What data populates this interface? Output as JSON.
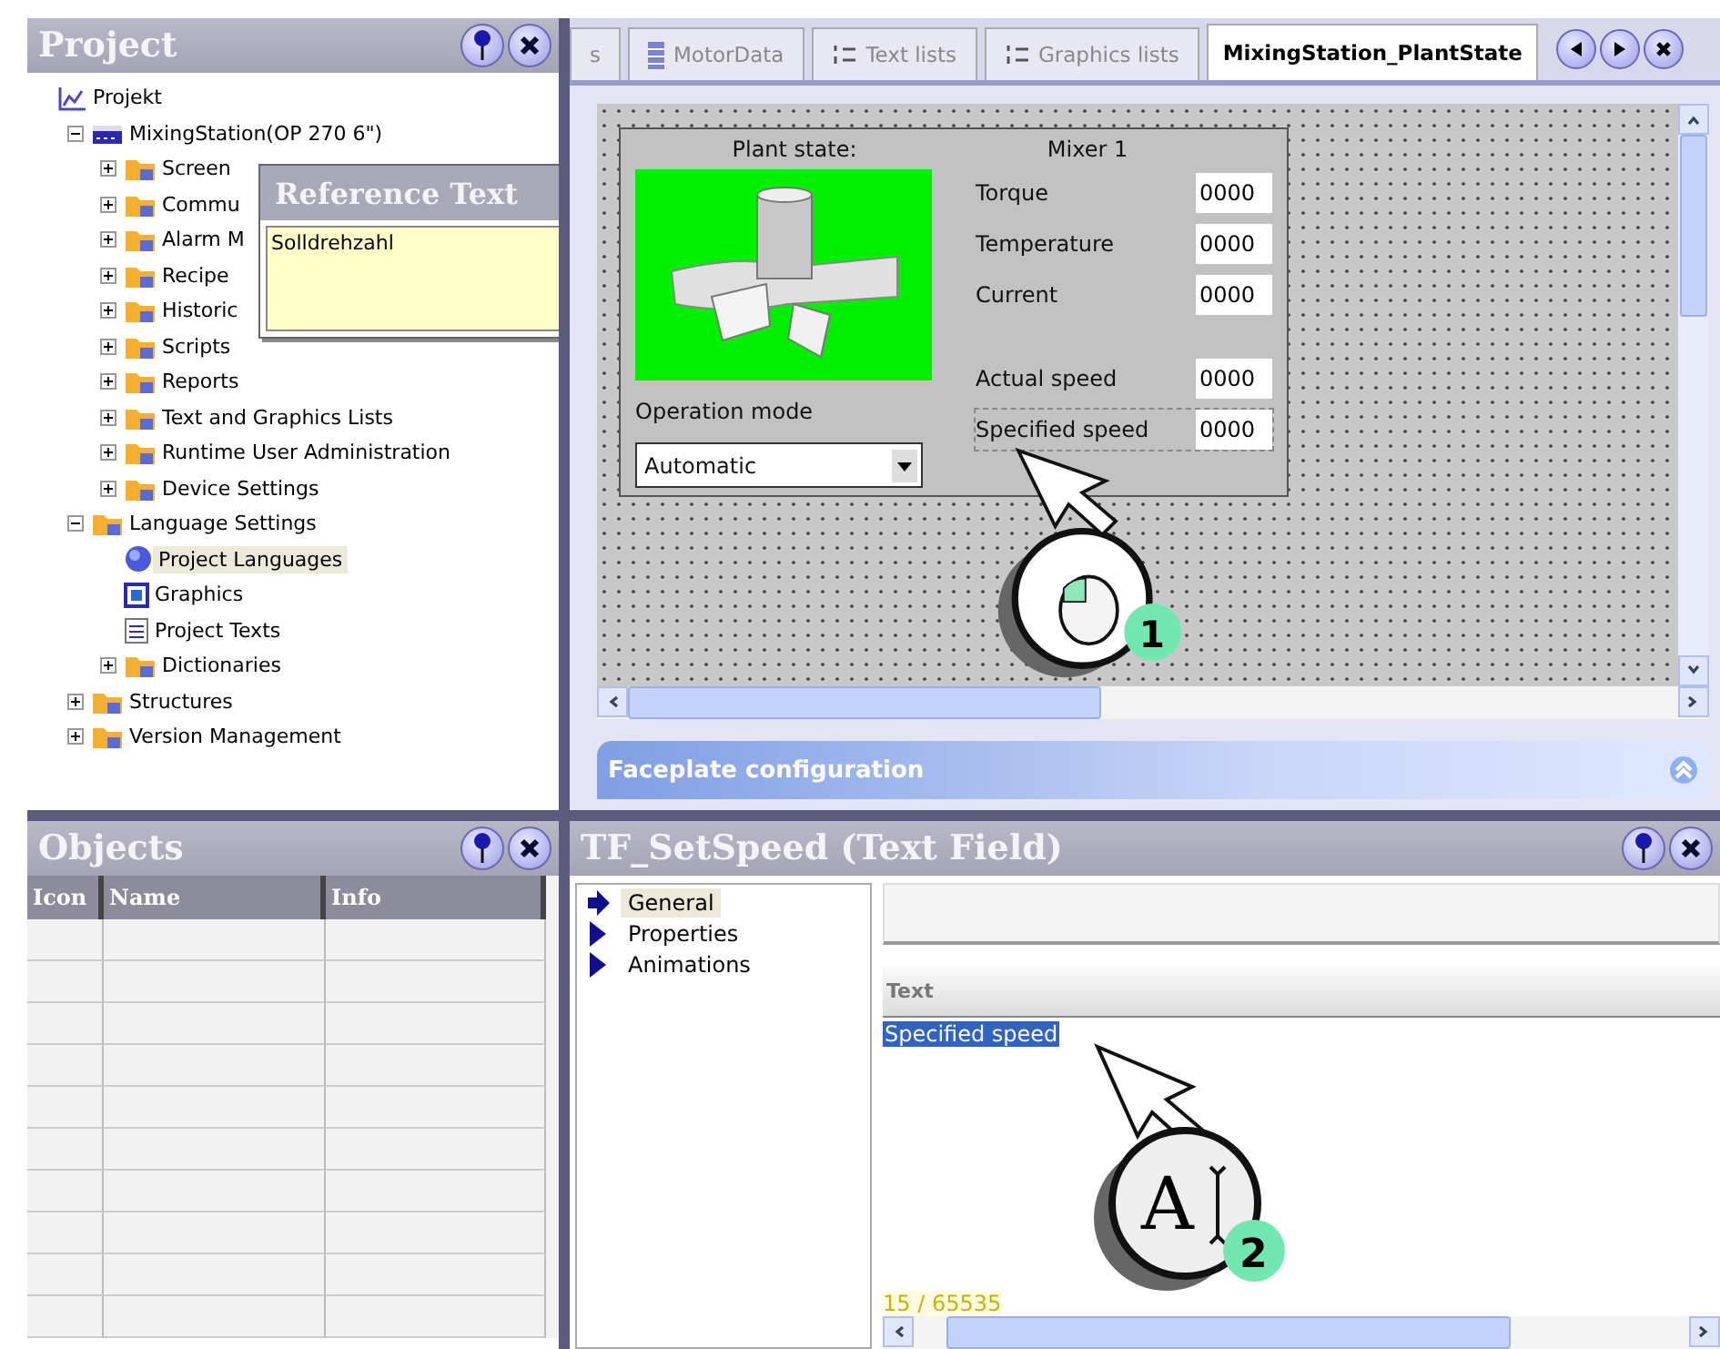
{
  "project_panel": {
    "title": "Project",
    "tree": [
      {
        "label": "Projekt",
        "kind": "chart",
        "children": [
          {
            "label": "MixingStation(OP 270 6\")",
            "kind": "device",
            "expanded": true,
            "selected": false,
            "children": [
              {
                "label": "Screen",
                "kind": "folder",
                "expanded": false,
                "selected": false
              },
              {
                "label": "Commu",
                "kind": "folder",
                "expanded": false,
                "selected": false
              },
              {
                "label": "Alarm M",
                "kind": "folder",
                "expanded": false,
                "selected": false
              },
              {
                "label": "Recipe",
                "kind": "folder",
                "expanded": false,
                "selected": false
              },
              {
                "label": "Historic",
                "kind": "folder",
                "expanded": false,
                "selected": false
              },
              {
                "label": "Scripts",
                "kind": "folder",
                "expanded": false,
                "selected": false
              },
              {
                "label": "Reports",
                "kind": "folder",
                "expanded": false,
                "selected": false
              },
              {
                "label": "Text and Graphics Lists",
                "kind": "folder",
                "expanded": false,
                "selected": false
              },
              {
                "label": "Runtime User Administration",
                "kind": "folder",
                "expanded": false,
                "selected": false
              },
              {
                "label": "Device Settings",
                "kind": "folder",
                "expanded": false,
                "selected": false
              }
            ]
          },
          {
            "label": "Language Settings",
            "kind": "folder",
            "expanded": true,
            "selected": false,
            "children": [
              {
                "label": "Project Languages",
                "kind": "globe",
                "selected": true
              },
              {
                "label": "Graphics",
                "kind": "picture",
                "selected": false
              },
              {
                "label": "Project Texts",
                "kind": "document",
                "selected": false
              },
              {
                "label": "Dictionaries",
                "kind": "folder",
                "expanded": false,
                "selected": false
              }
            ]
          },
          {
            "label": "Structures",
            "kind": "folder",
            "expanded": false,
            "selected": false
          },
          {
            "label": "Version Management",
            "kind": "folder",
            "expanded": false,
            "selected": false
          }
        ]
      }
    ]
  },
  "reference_popup": {
    "title": "Reference Text",
    "value": "Solldrehzahl"
  },
  "editor_tabs": [
    {
      "label": "s",
      "kind": "plain",
      "selected": false
    },
    {
      "label": "MotorData",
      "kind": "table",
      "selected": false
    },
    {
      "label": "Text lists",
      "kind": "list",
      "selected": false
    },
    {
      "label": "Graphics lists",
      "kind": "list",
      "selected": false
    },
    {
      "label": "MixingStation_PlantState",
      "kind": "plain",
      "selected": true
    }
  ],
  "faceplate": {
    "heading": "Plant state:",
    "unit": "Mixer 1",
    "mode_label": "Operation mode",
    "mode_value": "Automatic",
    "readings": [
      {
        "label": "Torque",
        "value": "0000",
        "selected": false
      },
      {
        "label": "Temperature",
        "value": "0000",
        "selected": false
      },
      {
        "label": "Current",
        "value": "0000",
        "selected": false
      }
    ],
    "speed_readings": [
      {
        "label": "Actual speed",
        "value": "0000",
        "selected": false
      },
      {
        "label": "Specified speed",
        "value": "0000",
        "selected": true
      }
    ]
  },
  "faceplate_bar": {
    "title": "Faceplate configuration"
  },
  "objects_panel": {
    "title": "Objects",
    "columns": [
      "Icon",
      "Name",
      "Info"
    ]
  },
  "properties_panel": {
    "title": "TF_SetSpeed (Text Field)",
    "nav": [
      {
        "label": "General",
        "selected": true
      },
      {
        "label": "Properties",
        "selected": false
      },
      {
        "label": "Animations",
        "selected": false
      }
    ],
    "section": "Text",
    "text_value": "Specified speed",
    "counter": "15 / 65535"
  },
  "callouts": [
    {
      "step": "1",
      "kind": "mouse"
    },
    {
      "step": "2",
      "kind": "text",
      "glyph": "A"
    }
  ]
}
